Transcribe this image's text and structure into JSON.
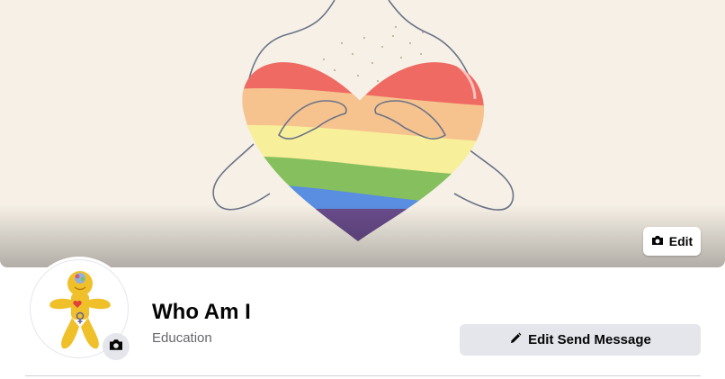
{
  "cover": {
    "edit_label": "Edit",
    "edit_icon": "camera-icon"
  },
  "profile": {
    "avatar_camera_icon": "camera-icon"
  },
  "page": {
    "name": "Who Am I",
    "category": "Education"
  },
  "actions": {
    "edit_send_message_label": "Edit Send Message",
    "edit_send_message_icon": "pencil-icon"
  },
  "colors": {
    "button_gray": "#e4e6eb",
    "text_primary": "#050505",
    "text_secondary": "#65676b",
    "cover_background": "#f6f0e6",
    "rainbow": [
      "#ef6a62",
      "#f6c38e",
      "#f8ef9a",
      "#86c05e",
      "#5a8ee0",
      "#6a4c8c"
    ]
  }
}
